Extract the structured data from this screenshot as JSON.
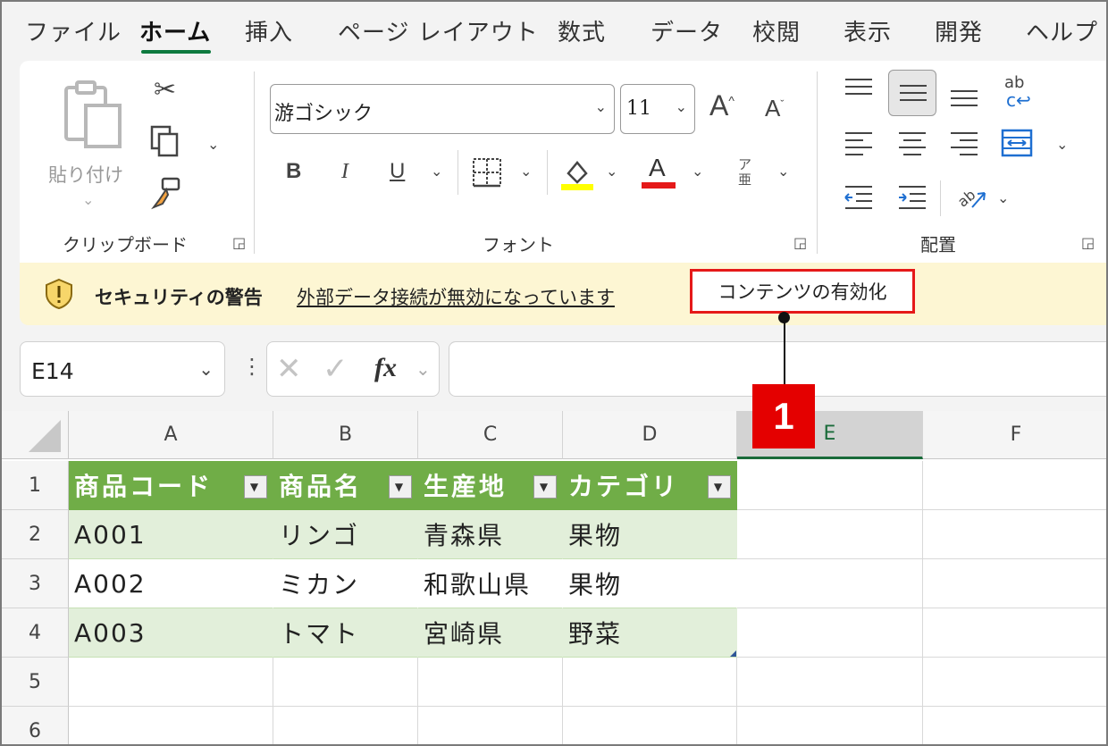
{
  "menu": {
    "tabs": [
      "ファイル",
      "ホーム",
      "挿入",
      "ページ レイアウト",
      "数式",
      "データ",
      "校閲",
      "表示",
      "開発",
      "ヘルプ"
    ],
    "active_tab": "ホーム"
  },
  "ribbon": {
    "clipboard": {
      "paste_label": "貼り付け",
      "group_label": "クリップボード"
    },
    "font": {
      "font_name": "游ゴシック",
      "font_size": "11",
      "group_label": "フォント",
      "bold": "B",
      "italic": "I",
      "underline": "U",
      "font_color_glyph": "A",
      "grow_glyph": "A",
      "shrink_glyph": "A",
      "phonetic_glyph": "ア亜",
      "highlight_color": "#ffff00",
      "font_color": "#e51919"
    },
    "alignment": {
      "group_label": "配置",
      "wrap_glyph": "ab"
    }
  },
  "security": {
    "title": "セキュリティの警告",
    "message": "外部データ接続が無効になっています",
    "enable_button": "コンテンツの有効化"
  },
  "formula_bar": {
    "name_box": "E14",
    "fx_label": "fx",
    "formula": ""
  },
  "grid": {
    "columns": [
      "A",
      "B",
      "C",
      "D",
      "E",
      "F"
    ],
    "selected_column": "E",
    "rows": [
      "1",
      "2",
      "3",
      "4",
      "5",
      "6"
    ],
    "table": {
      "headers": [
        "商品コード",
        "商品名",
        "生産地",
        "カテゴリ"
      ],
      "rows": [
        [
          "A001",
          "リンゴ",
          "青森県",
          "果物"
        ],
        [
          "A002",
          "ミカン",
          "和歌山県",
          "果物"
        ],
        [
          "A003",
          "トマト",
          "宮崎県",
          "野菜"
        ]
      ],
      "header_color": "#70ad47",
      "band_color": "#e2efda"
    }
  },
  "annotation": {
    "step_number": "1",
    "highlight_color": "#e51919"
  }
}
